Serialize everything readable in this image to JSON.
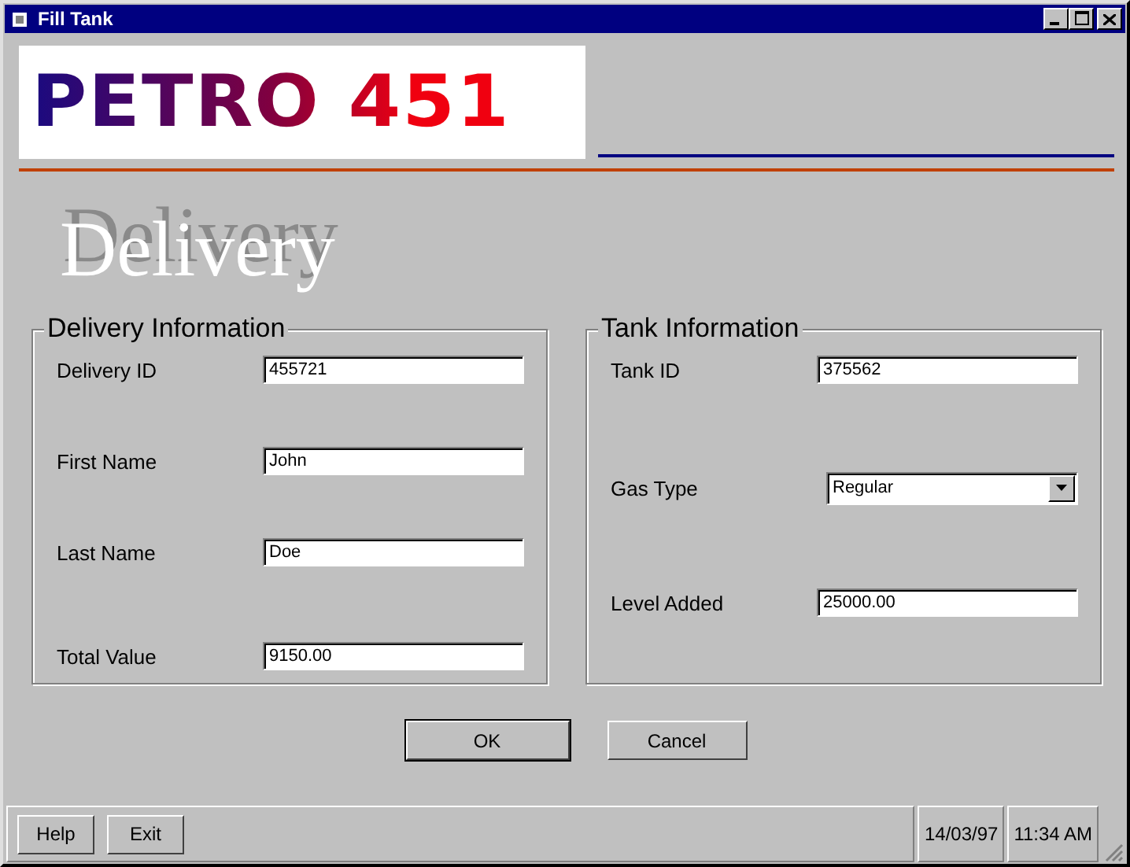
{
  "window": {
    "title": "Fill Tank"
  },
  "logo": {
    "text": "PETRO 451"
  },
  "heading": {
    "text": "Delivery"
  },
  "groups": [
    {
      "title": "Delivery Information",
      "fields": [
        {
          "kind": "text",
          "label": "Delivery ID",
          "value": "455721"
        },
        {
          "kind": "text",
          "label": "First Name",
          "value": "John"
        },
        {
          "kind": "text",
          "label": "Last Name",
          "value": "Doe"
        },
        {
          "kind": "text",
          "label": "Total Value",
          "value": "9150.00"
        }
      ]
    },
    {
      "title": "Tank Information",
      "fields": [
        {
          "kind": "text",
          "label": "Tank ID",
          "value": "375562"
        },
        {
          "kind": "dropdown",
          "label": "Gas Type",
          "value": "Regular"
        },
        {
          "kind": "text",
          "label": "Level Added",
          "value": "25000.00"
        }
      ]
    }
  ],
  "buttons": [
    {
      "label": "OK",
      "default": true
    },
    {
      "label": "Cancel",
      "default": false
    }
  ],
  "status_bar": {
    "buttons": [
      "Help",
      "Exit"
    ],
    "date": "14/03/97",
    "time": "11:34 AM"
  }
}
